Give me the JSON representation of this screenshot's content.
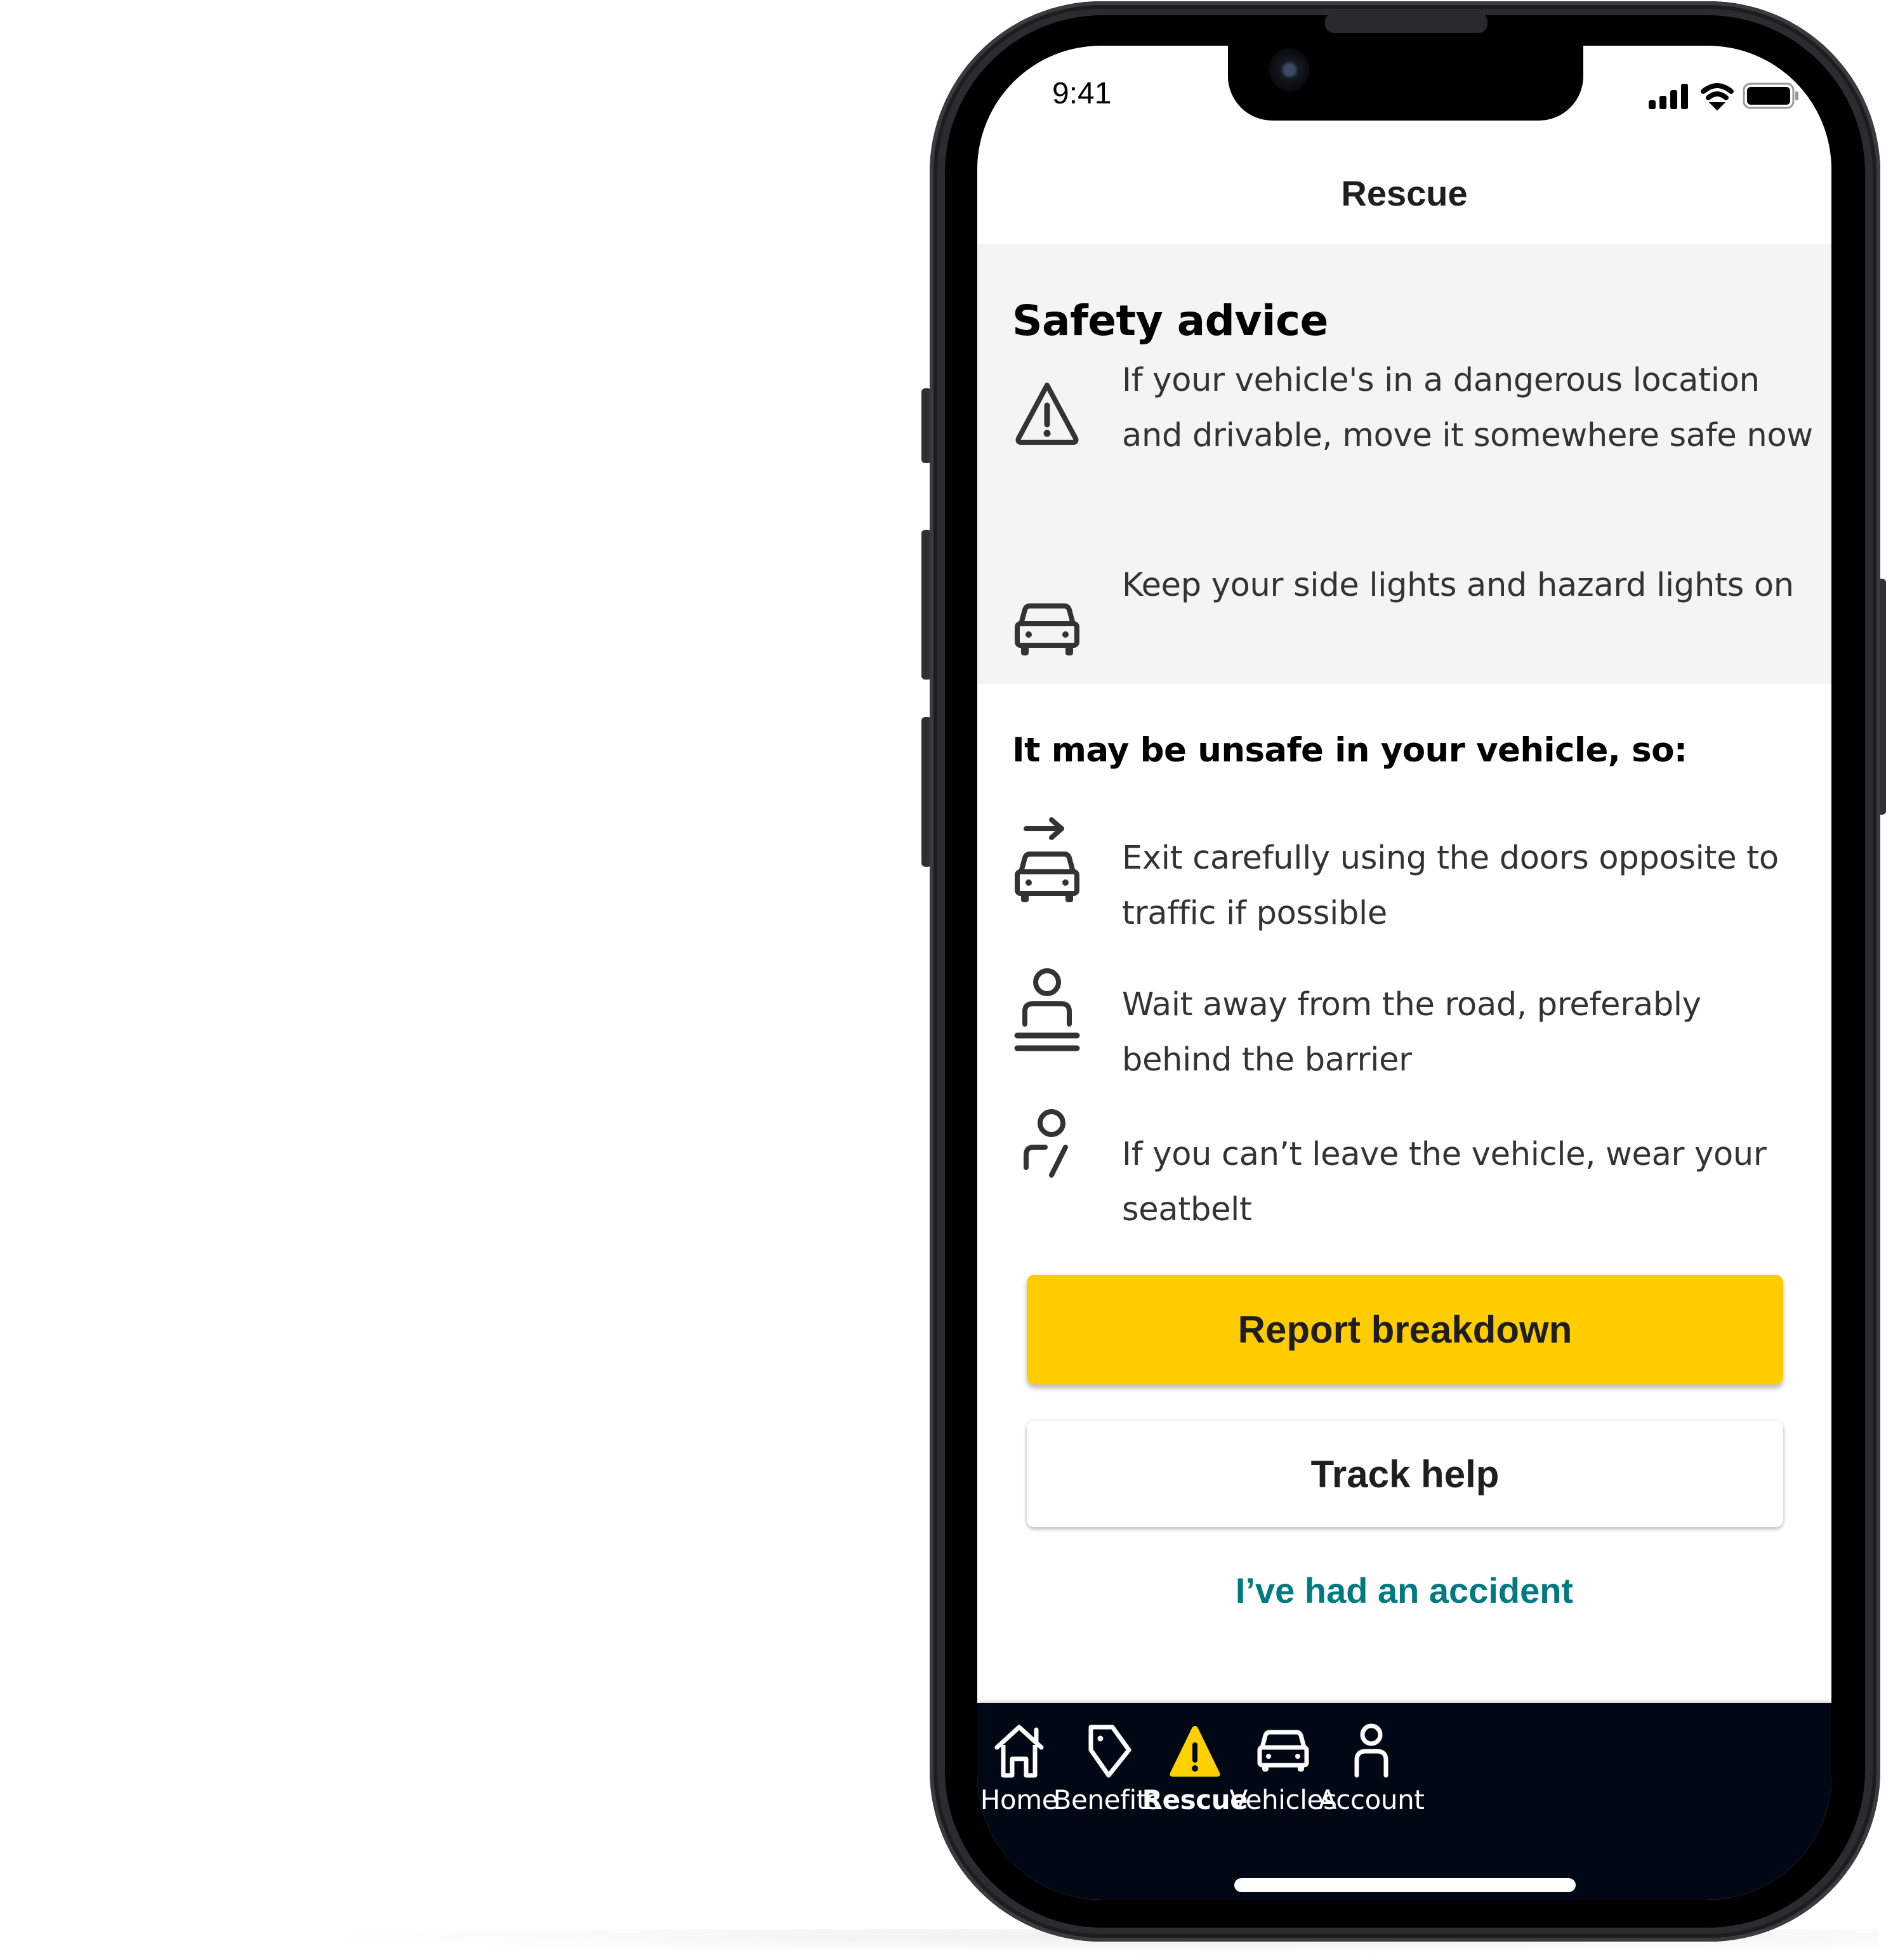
{
  "status_bar": {
    "time": "9:41",
    "icons": [
      "cellular-signal-icon",
      "wifi-icon",
      "battery-icon"
    ]
  },
  "header": {
    "title": "Rescue"
  },
  "safety_advice": {
    "title": "Safety advice",
    "items": [
      {
        "icon": "warning-triangle-icon",
        "text": "If your vehicle's in a dangerous location and drivable, move it somewhere safe now"
      },
      {
        "icon": "car-icon",
        "text": "Keep your side lights and hazard lights on"
      }
    ]
  },
  "unsafe_section": {
    "title": "It may be unsafe in your vehicle, so:",
    "items": [
      {
        "icon": "car-exit-arrow-icon",
        "text": "Exit carefully using the doors opposite to traffic if possible"
      },
      {
        "icon": "person-behind-barrier-icon",
        "text": "Wait away from the road, preferably behind the barrier"
      },
      {
        "icon": "person-seatbelt-icon",
        "text": "If you can’t leave the vehicle, wear your seatbelt"
      }
    ]
  },
  "actions": {
    "primary_label": "Report breakdown",
    "secondary_label": "Track help",
    "link_label": "I’ve had an accident"
  },
  "tab_bar": {
    "active": "Rescue",
    "items": [
      {
        "label": "Home",
        "icon": "home-icon"
      },
      {
        "label": "Benefits",
        "icon": "tag-icon"
      },
      {
        "label": "Rescue",
        "icon": "warning-triangle-icon"
      },
      {
        "label": "Vehicles",
        "icon": "car-icon"
      },
      {
        "label": "Account",
        "icon": "person-icon"
      }
    ]
  },
  "colors": {
    "primary_button": "#ffcc00",
    "link": "#007a80",
    "tab_bar_bg": "#000816",
    "advice_bg": "#f4f4f4",
    "active_tab_icon": "#ffd100"
  }
}
